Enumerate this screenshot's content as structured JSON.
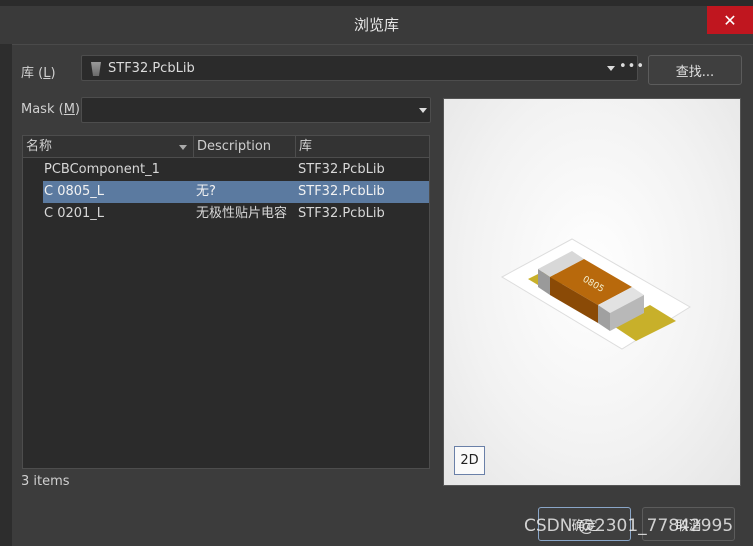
{
  "window": {
    "title": "浏览库",
    "close_glyph": "✕"
  },
  "library": {
    "label": "库 (L)",
    "label_text": "库 (",
    "label_key": "L",
    "label_end": ")",
    "value": "STF32.PcbLib",
    "more_glyph": "•••",
    "find_button": "查找..."
  },
  "mask": {
    "label_text": "Mask (",
    "label_key": "M",
    "label_end": ")",
    "value": ""
  },
  "table": {
    "columns": [
      "名称",
      "Description",
      "库"
    ],
    "rows": [
      {
        "name": "PCBComponent_1",
        "description": "",
        "library": "STF32.PcbLib",
        "selected": false
      },
      {
        "name": "C 0805_L",
        "description": "无?",
        "library": "STF32.PcbLib",
        "selected": true
      },
      {
        "name": "C 0201_L",
        "description": "无极性贴片电容",
        "library": "STF32.PcbLib",
        "selected": false
      }
    ]
  },
  "status": {
    "items": "3 items"
  },
  "preview": {
    "component_marking": "0805",
    "view_button": "2D"
  },
  "footer": {
    "ok": "确定",
    "cancel": "取消"
  },
  "watermark": "CSDN @2301_77842995",
  "colors": {
    "selection": "#5b7aa0",
    "close": "#c0161f",
    "body": "#b8690c",
    "pads": "#c8b02a"
  }
}
